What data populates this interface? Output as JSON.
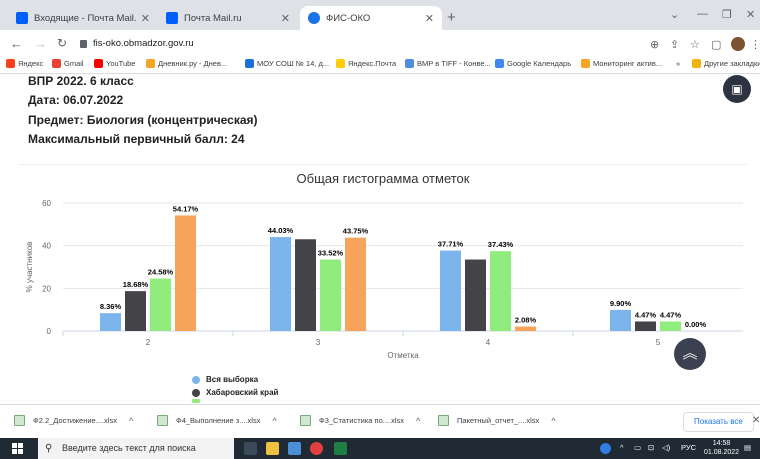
{
  "tabs": [
    {
      "title": "Входящие - Почта Mail.ru",
      "close": "✕"
    },
    {
      "title": "Почта Mail.ru",
      "close": "✕"
    },
    {
      "title": "ФИС-ОКО",
      "close": "✕"
    }
  ],
  "new_tab": "+",
  "address": {
    "url": "fis-oko.obmadzor.gov.ru"
  },
  "bookmarks": [
    {
      "label": "Яндекс",
      "color": "#fc3f1d"
    },
    {
      "label": "Gmail",
      "color": "#ea4335"
    },
    {
      "label": "YouTube",
      "color": "#ff0000"
    },
    {
      "label": "Дневник.ру - Днев...",
      "color": "#f5a623"
    },
    {
      "label": "МОУ СОШ № 14, д...",
      "color": "#1e6fd9"
    },
    {
      "label": "Яндекс.Почта",
      "color": "#ffcc00"
    },
    {
      "label": "BMP в TIFF - Конве...",
      "color": "#4f8edc"
    },
    {
      "label": "Google Календарь",
      "color": "#4285f4"
    },
    {
      "label": "Мониторинг актив...",
      "color": "#f5a623"
    },
    {
      "label": "Другие закладки",
      "color": "#f0b400"
    }
  ],
  "bookmarks_more": "»",
  "info": {
    "exam": "ВПР 2022. 6 класс",
    "date": "Дата: 06.07.2022",
    "subject": "Предмет: Биология (концентрическая)",
    "max_score": "Максимальный первичный балл: 24"
  },
  "chart_data": {
    "type": "bar",
    "title": "Общая гистограмма отметок",
    "xlabel": "Отметка",
    "ylabel": "% участников",
    "ylim": [
      0,
      60
    ],
    "yticks": [
      0,
      20,
      40,
      60
    ],
    "grid": true,
    "categories": [
      "2",
      "3",
      "4",
      "5"
    ],
    "series": [
      {
        "name": "Вся выборка",
        "color": "#7cb5ec",
        "values": [
          8.36,
          44.03,
          37.71,
          9.9
        ],
        "labels": [
          "8.36%",
          "44.03%",
          "37.71%",
          "9.90%"
        ]
      },
      {
        "name": "Хабаровский край",
        "color": "#434348",
        "values": [
          18.68,
          43.0,
          33.5,
          4.47
        ],
        "labels": [
          "18.68%",
          "",
          "",
          "4.47%"
        ]
      },
      {
        "name": "",
        "color": "#90ed7d",
        "values": [
          24.58,
          33.52,
          37.43,
          4.47
        ],
        "labels": [
          "24.58%",
          "33.52%",
          "37.43%",
          "4.47%"
        ]
      },
      {
        "name": "",
        "color": "#f7a35c",
        "values": [
          54.17,
          43.75,
          2.08,
          0.0
        ],
        "labels": [
          "54.17%",
          "43.75%",
          "2.08%",
          "0.00%"
        ]
      }
    ],
    "legend_position": "bottom-left"
  },
  "legend": [
    {
      "label": "Вся выборка",
      "color": "#7cb5ec"
    },
    {
      "label": "Хабаровский край",
      "color": "#434348"
    }
  ],
  "downloads": [
    {
      "name": "Ф2.2_Достижение....xlsx"
    },
    {
      "name": "Ф4_Выполнение з....xlsx"
    },
    {
      "name": "Ф3_Статистика по....xlsx"
    },
    {
      "name": "Пакетный_отчет_....xlsx"
    }
  ],
  "downloads_show_all": "Показать все",
  "taskbar": {
    "search_placeholder": "Введите здесь текст для поиска",
    "lang": "РУС",
    "time": "14:58",
    "date": "01.08.2022"
  }
}
